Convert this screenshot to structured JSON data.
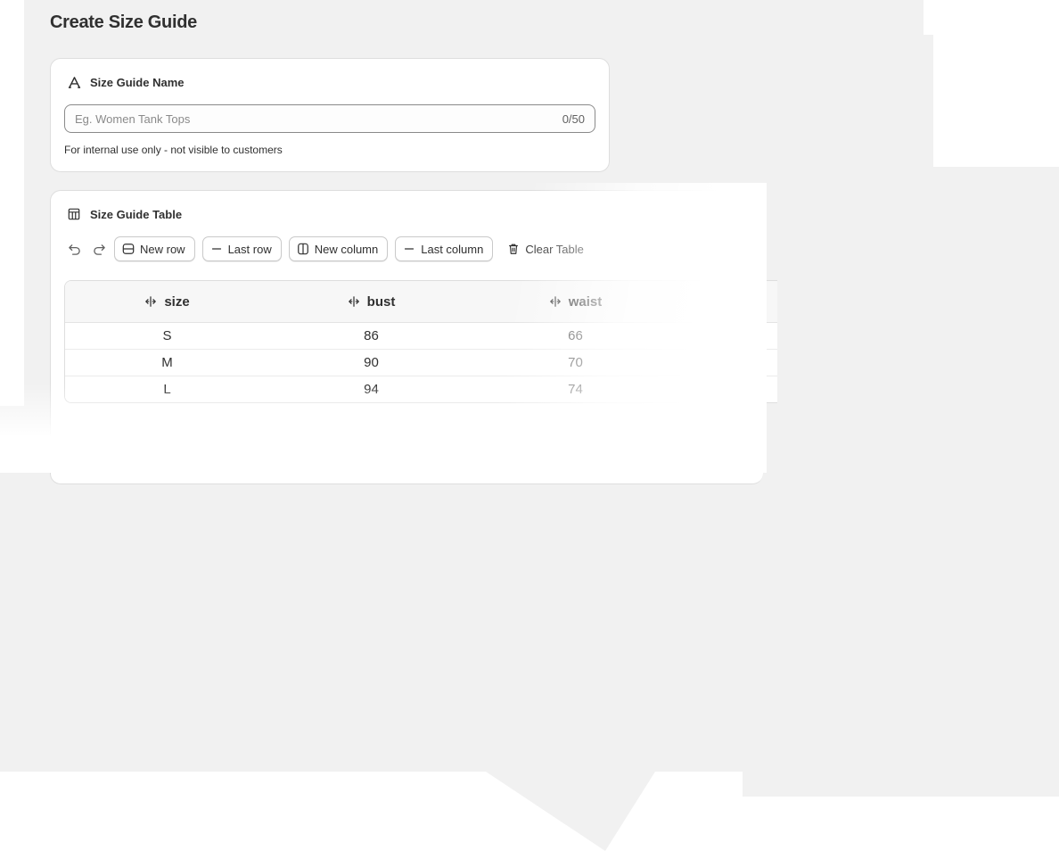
{
  "page": {
    "title": "Create Size Guide"
  },
  "name_card": {
    "heading": "Size Guide Name",
    "heading_icon": "text-a-icon",
    "input_placeholder": "Eg. Women Tank Tops",
    "input_value": "",
    "char_count": "0/50",
    "help_text": "For internal use only - not visible to customers"
  },
  "table_card": {
    "heading": "Size Guide Table",
    "heading_icon": "table-icon",
    "toolbar": {
      "undo_icon": "undo-icon",
      "redo_icon": "redo-icon",
      "new_row": "New row",
      "last_row": "Last row",
      "new_column": "New column",
      "last_column": "Last column",
      "clear_table": "Clear Table"
    },
    "columns": [
      "size",
      "bust",
      "waist"
    ],
    "rows": [
      [
        "S",
        "86",
        "66"
      ],
      [
        "M",
        "90",
        "70"
      ],
      [
        "L",
        "94",
        "74"
      ]
    ]
  },
  "colors": {
    "background": "#f1f1f1",
    "card": "#ffffff",
    "text": "#303030",
    "border": "#dedede"
  }
}
